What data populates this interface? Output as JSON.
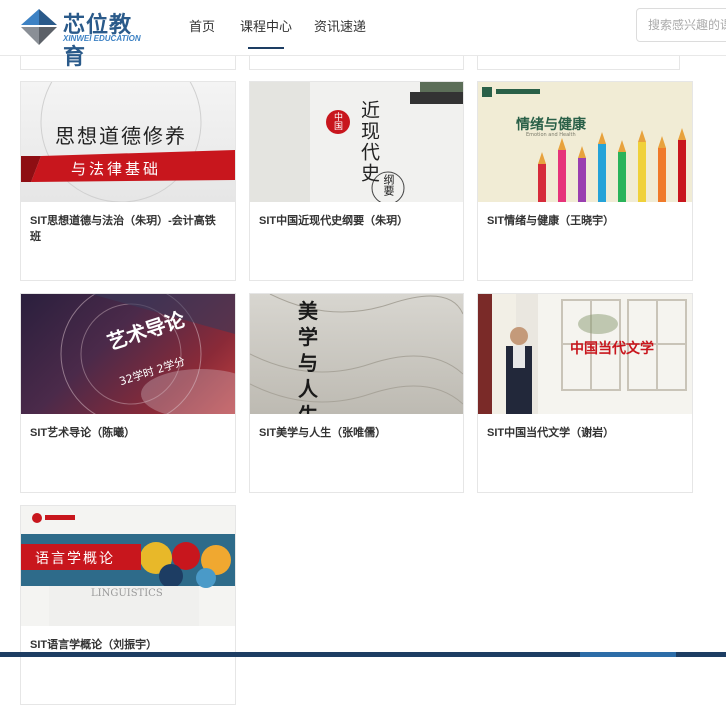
{
  "brand": {
    "name_cn": "芯位教育",
    "name_en": "XINWEI EDUCATION"
  },
  "nav": [
    {
      "label": "首页",
      "active": false
    },
    {
      "label": "课程中心",
      "active": true
    },
    {
      "label": "资讯速递",
      "active": false
    }
  ],
  "search": {
    "placeholder": "搜索感兴趣的课"
  },
  "courses": [
    {
      "title": "SIT思想道德与法治（朱玥）-会计高铁班",
      "thumb_text": [
        "思想道德修养",
        "与法律基础"
      ]
    },
    {
      "title": "SIT中国近现代史纲要（朱玥）",
      "thumb_text": [
        "近现代史",
        "中国",
        "纲要"
      ]
    },
    {
      "title": "SIT情绪与健康（王晓宇）",
      "thumb_text": [
        "情绪与健康",
        "Emotion and Health"
      ]
    },
    {
      "title": "SIT艺术导论（陈曦）",
      "thumb_text": [
        "艺术导论",
        "32学时  2学分"
      ]
    },
    {
      "title": "SIT美学与人生（张唯儒）",
      "thumb_text": [
        "美学与人生"
      ]
    },
    {
      "title": "SIT中国当代文学（谢岩）",
      "thumb_text": [
        "中国当代文学"
      ]
    },
    {
      "title": "SIT语言学概论（刘振宇）",
      "thumb_text": [
        "语言学概论",
        "LINGUISTICS"
      ]
    }
  ],
  "colors": {
    "brand_dark": "#1d3d63",
    "brand_blue": "#3d82c4"
  }
}
